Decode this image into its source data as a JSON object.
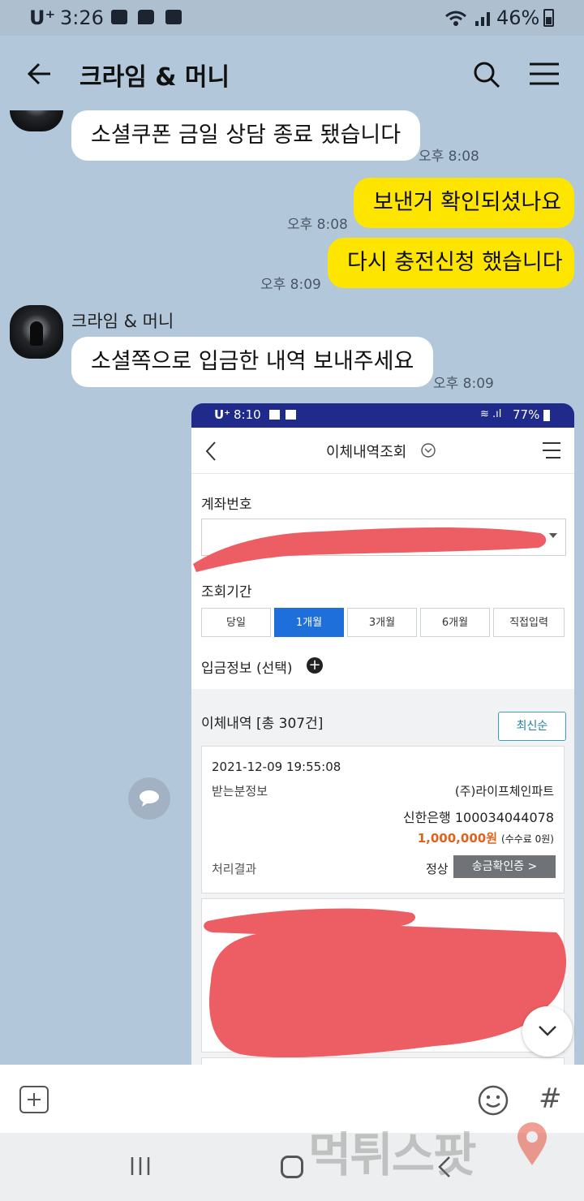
{
  "status": {
    "carrier": "U⁺",
    "time": "3:26",
    "battery": "46%"
  },
  "header": {
    "title": "크라임 & 머니"
  },
  "messages": {
    "m1": {
      "text": "소셜쿠폰 금일 상담 종료 됐습니다",
      "time": "오후 8:08"
    },
    "m2": {
      "text": "보낸거 확인되셨나요",
      "time": "오후 8:08"
    },
    "m3": {
      "text": "다시 충전신청 했습니다",
      "time": "오후 8:09"
    },
    "m4": {
      "sender": "크라임 & 머니",
      "text": "소셜쪽으로 입금한 내역 보내주세요",
      "time": "오후 8:09"
    }
  },
  "screenshot": {
    "status": {
      "carrier": "U⁺",
      "time": "8:10",
      "battery": "77%"
    },
    "title": "이체내역조회",
    "account_label": "계좌번호",
    "period_label": "조회기간",
    "periods": [
      "당일",
      "1개월",
      "3개월",
      "6개월",
      "직접입력"
    ],
    "selected_period": "1개월",
    "deposit_label": "입금정보 (선택)",
    "history_label": "이체내역 [총 307건]",
    "sort_button": "최신순",
    "record": {
      "datetime": "2021-12-09 19:55:08",
      "recipient_label": "받는분정보",
      "recipient": "(주)라이프체인파트",
      "bank_account": "신한은행 100034044078",
      "amount": "1,000,000원",
      "fee": "(수수료 0원)",
      "result_label": "처리결과",
      "result": "정상",
      "confirm_button": "송금확인증 >"
    }
  },
  "watermark": "먹튀스팟",
  "colors": {
    "chat_bg": "#b2c7d9",
    "my_bubble": "#fee500",
    "bank_blue": "#1e6fd9",
    "amount": "#e2621b",
    "redaction": "#ec5e63"
  }
}
